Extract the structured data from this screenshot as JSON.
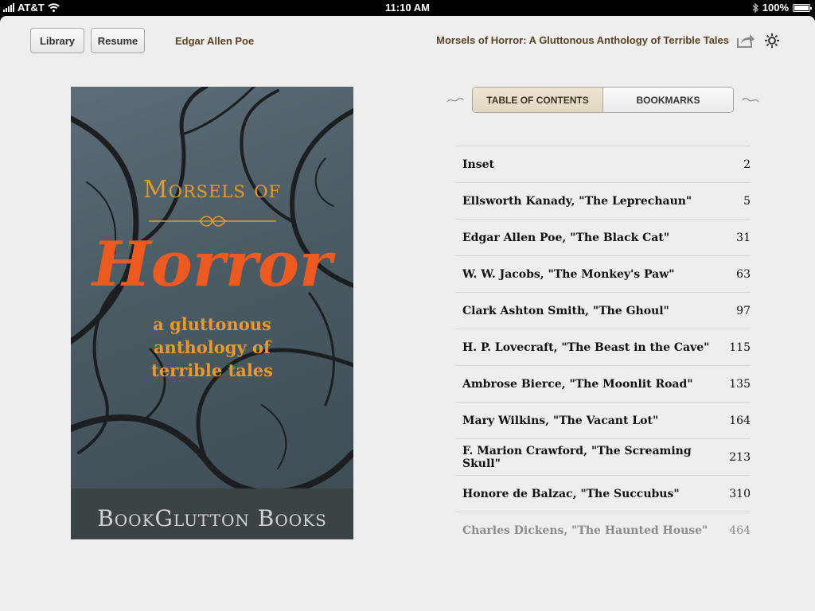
{
  "status": {
    "carrier": "AT&T",
    "time": "11:10 AM",
    "battery": "100%",
    "battery_level": 1.0
  },
  "header": {
    "library_label": "Library",
    "resume_label": "Resume",
    "author": "Edgar Allen Poe",
    "book_title": "Morsels of Horror: A Gluttonous Anthology of Terrible Tales"
  },
  "cover": {
    "title_line1": "Morsels of",
    "title_line2": "Horror",
    "subtitle": "a gluttonous\nanthology of\nterrible tales",
    "publisher": "BookGlutton Books"
  },
  "tabs": [
    {
      "label": "TABLE OF CONTENTS",
      "active": true
    },
    {
      "label": "BOOKMARKS",
      "active": false
    }
  ],
  "toc": [
    {
      "title": "Inset",
      "page": "2"
    },
    {
      "title": "Ellsworth Kanady, \"The Leprechaun\"",
      "page": "5"
    },
    {
      "title": "Edgar Allen Poe, \"The Black Cat\"",
      "page": "31"
    },
    {
      "title": "W. W. Jacobs, \"The Monkey's Paw\"",
      "page": "63"
    },
    {
      "title": "Clark Ashton Smith, \"The Ghoul\"",
      "page": "97"
    },
    {
      "title": "H. P. Lovecraft, \"The Beast in the Cave\"",
      "page": "115"
    },
    {
      "title": "Ambrose Bierce, \"The Moonlit Road\"",
      "page": "135"
    },
    {
      "title": "Mary Wilkins, \"The Vacant Lot\"",
      "page": "164"
    },
    {
      "title": "F. Marion Crawford, \"The Screaming Skull\"",
      "page": "213"
    },
    {
      "title": "Honore de Balzac, \"The Succubus\"",
      "page": "310"
    },
    {
      "title": "Charles Dickens, \"The Haunted House\"",
      "page": "464"
    }
  ],
  "colors": {
    "accent": "#5a4324",
    "cover_orange": "#ec5a22",
    "cover_gold": "#e79a2a"
  }
}
